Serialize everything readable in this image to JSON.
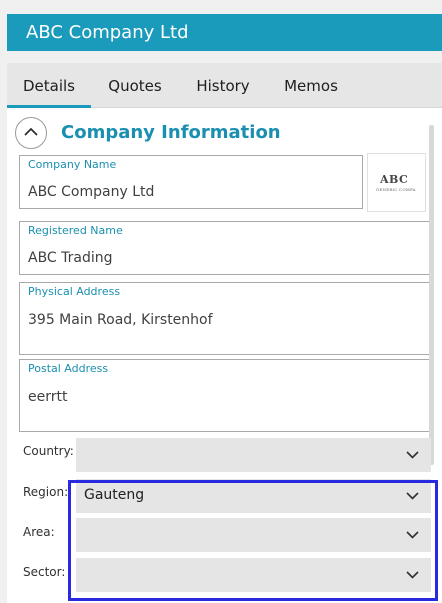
{
  "header": {
    "title": "ABC Company Ltd"
  },
  "tabs": [
    {
      "label": "Details",
      "active": true
    },
    {
      "label": "Quotes",
      "active": false
    },
    {
      "label": "History",
      "active": false
    },
    {
      "label": "Memos",
      "active": false
    }
  ],
  "section": {
    "title": "Company Information",
    "collapse_icon": "chevron-up-icon"
  },
  "logo": {
    "text": "ABC",
    "subtext": "GENERIC COMPA"
  },
  "fields": {
    "company_name": {
      "label": "Company Name",
      "value": "ABC Company Ltd"
    },
    "registered_name": {
      "label": "Registered Name",
      "value": "ABC Trading"
    },
    "physical_address": {
      "label": "Physical Address",
      "value": "395 Main Road, Kirstenhof"
    },
    "postal_address": {
      "label": "Postal Address",
      "value": "eerrtt"
    }
  },
  "dropdowns": {
    "country": {
      "label": "Country:",
      "value": ""
    },
    "region": {
      "label": "Region:",
      "value": "Gauteng"
    },
    "area": {
      "label": "Area:",
      "value": ""
    },
    "sector": {
      "label": "Sector:",
      "value": ""
    }
  },
  "colors": {
    "accent": "#1b9bbb",
    "highlight": "#2929e0",
    "label": "#1a8fb0"
  }
}
